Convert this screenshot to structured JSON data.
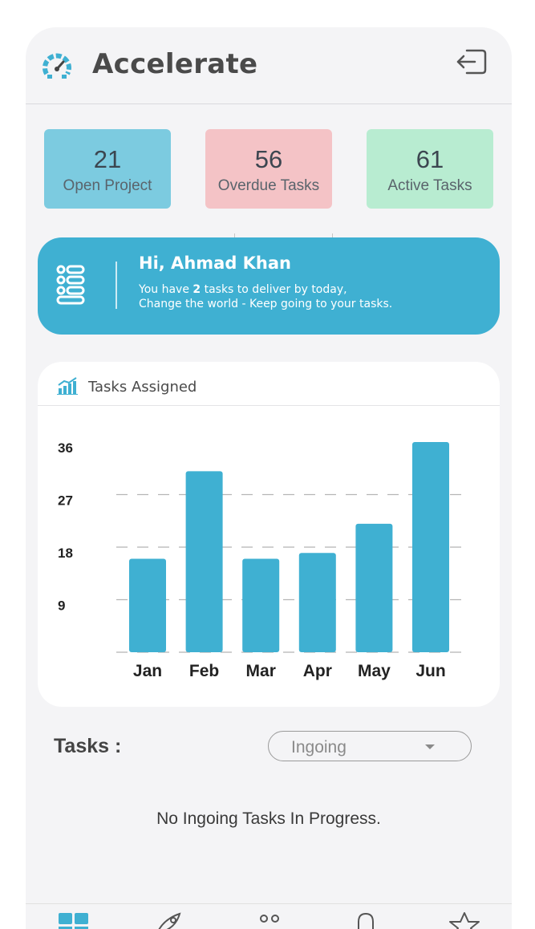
{
  "app": {
    "title": "Accelerate"
  },
  "stats": [
    {
      "value": "21",
      "label": "Open Project",
      "color": "#7ccbe0"
    },
    {
      "value": "56",
      "label": "Overdue Tasks",
      "color": "#f4c3c6"
    },
    {
      "value": "61",
      "label": "Active Tasks",
      "color": "#b8ecd1"
    }
  ],
  "greeting": {
    "title": "Hi, Ahmad Khan",
    "line1_pre": "You have ",
    "line1_count": "2",
    "line1_post": " tasks to deliver by today,",
    "line2": "Change the world - Keep going to your tasks."
  },
  "chart": {
    "title": "Tasks Assigned"
  },
  "chart_data": {
    "type": "bar",
    "categories": [
      "Jan",
      "Feb",
      "Mar",
      "Apr",
      "May",
      "Jun"
    ],
    "values": [
      16,
      31,
      16,
      17,
      22,
      36
    ],
    "yticks": [
      9,
      18,
      27,
      36
    ],
    "ylim": [
      0,
      36
    ],
    "bar_color": "#3fb0d2",
    "grid": "dashed horizontal",
    "title": "Tasks Assigned",
    "xlabel": "",
    "ylabel": ""
  },
  "tasks": {
    "label": "Tasks :",
    "filter_value": "Ingoing",
    "empty_message": "No Ingoing Tasks In Progress."
  },
  "nav": {
    "items": [
      {
        "icon": "dashboard-icon"
      },
      {
        "icon": "rocket-icon"
      },
      {
        "icon": "team-icon"
      },
      {
        "icon": "bell-icon"
      },
      {
        "icon": "star-icon"
      }
    ]
  },
  "colors": {
    "accent": "#3fb0d2",
    "background": "#f4f4f6"
  }
}
